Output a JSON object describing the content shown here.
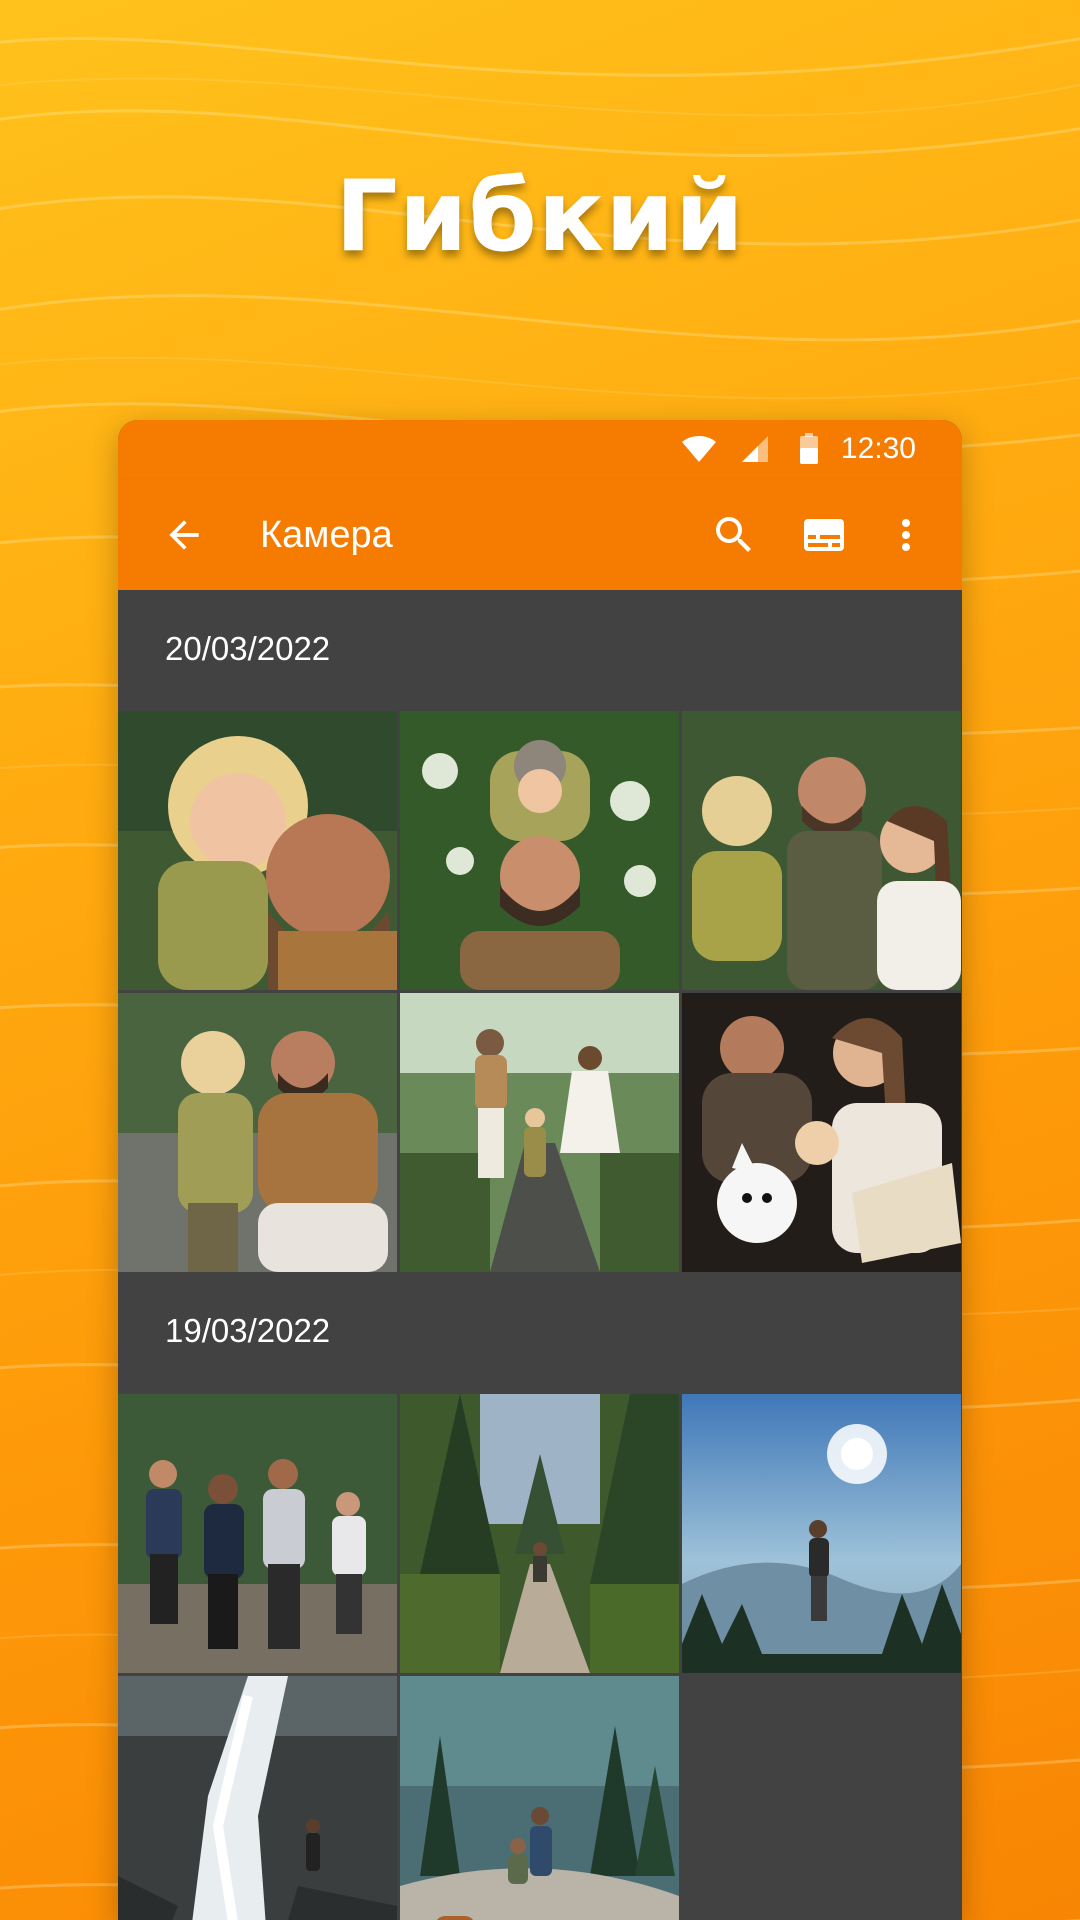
{
  "headline": "Гибкий",
  "status_bar": {
    "time": "12:30",
    "icons": [
      "wifi-icon",
      "signal-icon",
      "battery-icon"
    ]
  },
  "app_bar": {
    "title": "Камера",
    "icons": [
      "back-arrow-icon",
      "search-icon",
      "subtitles-icon",
      "more-vert-icon"
    ]
  },
  "colors": {
    "background_top": "#ffc21c",
    "background_bottom": "#f88604",
    "app_bar": "#f57c00",
    "content_background": "#424242",
    "text": "#ffffff"
  },
  "sections": [
    {
      "date": "20/03/2022",
      "photos": [
        "father-and-curly-child-smiling",
        "child-on-fathers-shoulders",
        "family-with-toddler-in-garden",
        "father-kneeling-with-toddler",
        "family-walking-on-path",
        "family-reading-with-dog"
      ]
    },
    {
      "date": "19/03/2022",
      "photos": [
        "group-of-hikers",
        "hiker-on-forest-trail",
        "hiker-facing-sun-over-mountains",
        "person-by-waterfall",
        "hikers-with-dog-on-cliff"
      ]
    }
  ]
}
